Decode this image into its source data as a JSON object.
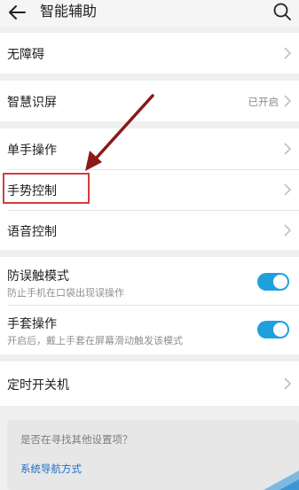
{
  "header": {
    "title": "智能辅助"
  },
  "items": {
    "accessibility": {
      "label": "无障碍"
    },
    "smart_screen": {
      "label": "智慧识屏",
      "status": "已开启"
    },
    "one_hand": {
      "label": "单手操作"
    },
    "gesture": {
      "label": "手势控制"
    },
    "voice": {
      "label": "语音控制"
    },
    "anti_touch": {
      "label": "防误触模式",
      "desc": "防止手机在口袋出现误操作",
      "enabled": true
    },
    "glove": {
      "label": "手套操作",
      "desc": "开启后，戴上手套在屏幕滑动触发该模式",
      "enabled": true
    },
    "timer_power": {
      "label": "定时开关机"
    }
  },
  "suggestion": {
    "question": "是否在寻找其他设置项？",
    "link": "系统导航方式"
  },
  "colors": {
    "accent": "#1ea0dc",
    "link": "#1b6fc7",
    "highlight": "#cf3e3e",
    "arrow": "#8a1a1a"
  }
}
